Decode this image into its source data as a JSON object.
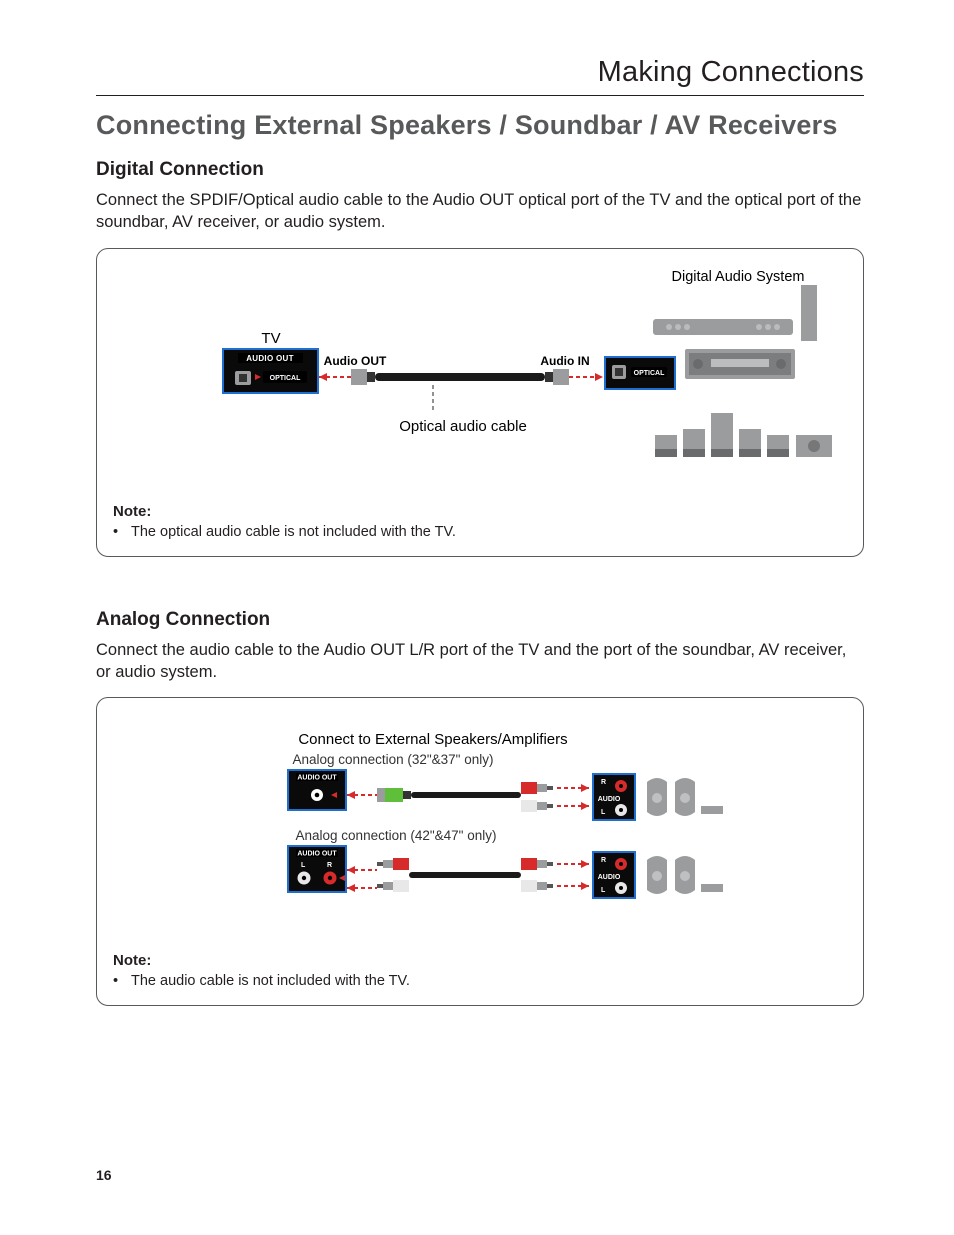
{
  "chapter": "Making Connections",
  "title": "Connecting External Speakers / Soundbar / AV Receivers",
  "page_number": "16",
  "digital": {
    "heading": "Digital Connection",
    "body": "Connect the SPDIF/Optical audio cable to the Audio OUT optical port of the TV and the optical port of the soundbar, AV receiver, or audio system.",
    "labels": {
      "tv": "TV",
      "system": "Digital Audio System",
      "audio_out": "Audio OUT",
      "audio_in": "Audio IN",
      "cable": "Optical audio cable",
      "port_out": "AUDIO OUT",
      "optical": "OPTICAL"
    },
    "note_heading": "Note:",
    "note_item": "The optical audio cable is not included with the TV."
  },
  "analog": {
    "heading": "Analog Connection",
    "body": "Connect the audio cable to the Audio OUT L/R port of the TV and the port of the soundbar, AV receiver, or audio system.",
    "labels": {
      "title": "Connect to External Speakers/Amplifiers",
      "row1": "Analog connection (32\"&37\" only)",
      "row2": "Analog connection (42\"&47\" only)",
      "port_out": "AUDIO OUT",
      "l": "L",
      "r": "R",
      "audio": "AUDIO"
    },
    "note_heading": "Note:",
    "note_item": "The audio cable is not included with the TV."
  }
}
